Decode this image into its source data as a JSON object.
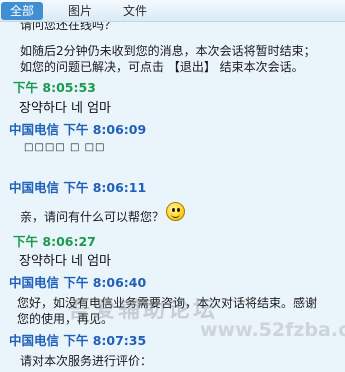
{
  "tabs": [
    {
      "label": "全部",
      "active": true
    },
    {
      "label": "图片",
      "active": false
    },
    {
      "label": "文件",
      "active": false
    }
  ],
  "intro": {
    "line1": "请问您还在线吗？",
    "line2": "如随后2分钟仍未收到您的消息，本次会话将暂时结束；",
    "line3": "如您的问题已解决，可点击 【退出】 结束本次会话。"
  },
  "messages": [
    {
      "sender": "下午",
      "time": "8:05:53",
      "body": "장약하다 네 엄마"
    },
    {
      "sender": "中国电信 下午",
      "time": "8:06:09",
      "body": "□□□□ □ □□"
    },
    {
      "sender": "中国电信 下午",
      "time": "8:06:11",
      "body": "亲，请问有什么可以帮您？"
    },
    {
      "sender": "下午",
      "time": "8:06:27",
      "body": "장약하다 네 엄마"
    },
    {
      "sender": "中国电信 下午",
      "time": "8:06:40",
      "body_line1": "您好，如没有电信业务需要咨询，本次对话将结束。感谢",
      "body_line2": "您的使用，再见。"
    },
    {
      "sender": "中国电信 下午",
      "time": "8:07:35",
      "body": "请对本次服务进行评价："
    }
  ],
  "watermark": {
    "title": "吾爱辅助论坛",
    "url": "www.52fzba.com"
  },
  "colors": {
    "me": "#1c9a4d",
    "service": "#1f60b8",
    "tab_active": "#3f8fd2",
    "background": "#eaf4fb"
  }
}
